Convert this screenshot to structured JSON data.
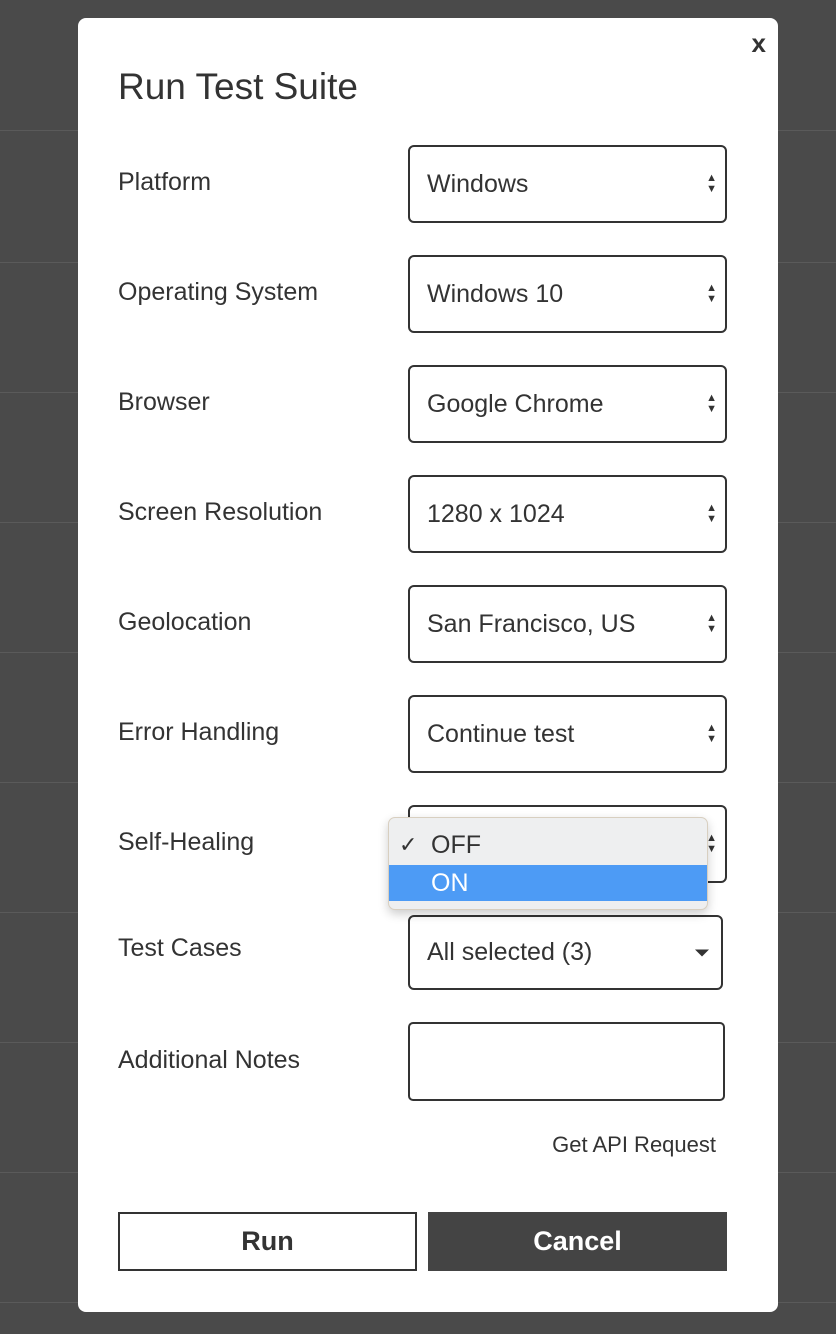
{
  "modal": {
    "title": "Run Test Suite",
    "close_label": "x",
    "fields": [
      {
        "label": "Platform",
        "value": "Windows"
      },
      {
        "label": "Operating System",
        "value": "Windows 10"
      },
      {
        "label": "Browser",
        "value": "Google Chrome"
      },
      {
        "label": "Screen Resolution",
        "value": "1280 x 1024"
      },
      {
        "label": "Geolocation",
        "value": "San Francisco, US"
      },
      {
        "label": "Error Handling",
        "value": "Continue test"
      },
      {
        "label": "Self-Healing",
        "value": "OFF"
      }
    ],
    "self_healing_options": [
      {
        "label": "OFF",
        "checked": true
      },
      {
        "label": "ON",
        "highlighted": true
      }
    ],
    "test_cases": {
      "label": "Test Cases",
      "value": "All selected (3)"
    },
    "notes": {
      "label": "Additional Notes",
      "value": ""
    },
    "api_link": "Get API Request",
    "run_label": "Run",
    "cancel_label": "Cancel"
  },
  "colors": {
    "highlight": "#4d9bf5",
    "cancel_bg": "#444444",
    "overlay": "#4a4a4a"
  }
}
